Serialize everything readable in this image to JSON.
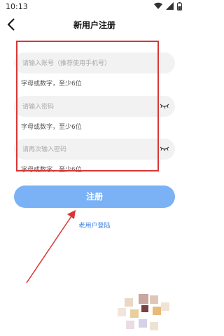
{
  "status_bar": {
    "time": "10:13"
  },
  "header": {
    "title": "新用户注册"
  },
  "form": {
    "account": {
      "placeholder": "请输入账号（推荐使用手机号）",
      "hint": "字母或数字，至少6位"
    },
    "password": {
      "placeholder": "请输入密码",
      "hint": "字母或数字，至少6位"
    },
    "confirm": {
      "placeholder": "请再次输入密码",
      "hint": "字母或数字，至少6位"
    }
  },
  "actions": {
    "register_label": "注册",
    "old_user_label": "老用户登陆"
  },
  "colors": {
    "accent": "#7ab2f5",
    "link": "#3b7de0",
    "annotation": "#d93535"
  }
}
